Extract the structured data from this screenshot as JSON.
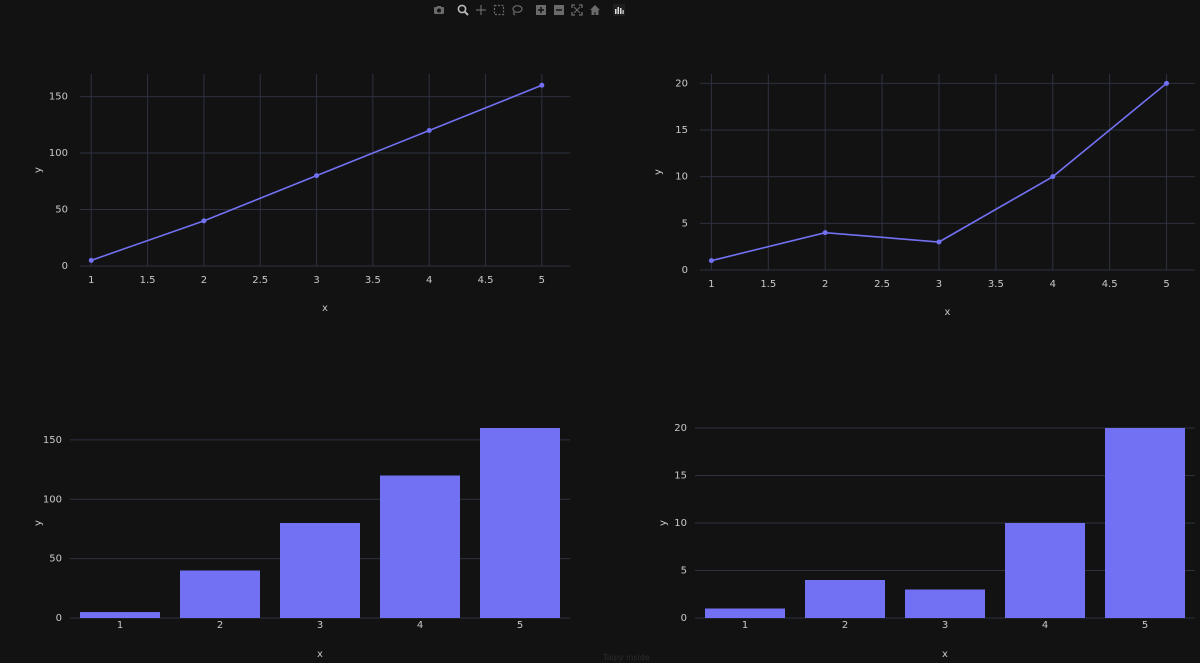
{
  "watermark": "Taipy inside",
  "modebar": {
    "icons": [
      "camera-icon",
      "zoom-icon",
      "pan-icon",
      "box-select-icon",
      "lasso-select-icon",
      "zoom-in-icon",
      "zoom-out-icon",
      "autoscale-icon",
      "reset-axes-icon",
      "plotly-logo-icon"
    ]
  },
  "colors": {
    "background": "#121212",
    "grid": "#2f3140",
    "axis_text": "#c8c8c8",
    "series": "#7371f3"
  },
  "chart_data": [
    {
      "type": "line",
      "x": [
        1,
        2,
        3,
        4,
        5
      ],
      "y": [
        5,
        40,
        80,
        120,
        160
      ],
      "xlabel": "x",
      "ylabel": "y",
      "xlim": [
        0.9,
        5.25
      ],
      "ylim": [
        0,
        170
      ],
      "xticks": [
        1,
        1.5,
        2,
        2.5,
        3,
        3.5,
        4,
        4.5,
        5
      ],
      "yticks": [
        0,
        50,
        100,
        150
      ],
      "grid": true
    },
    {
      "type": "line",
      "x": [
        1,
        2,
        3,
        4,
        5
      ],
      "y": [
        1,
        4,
        3,
        10,
        20
      ],
      "xlabel": "x",
      "ylabel": "y",
      "xlim": [
        0.9,
        5.25
      ],
      "ylim": [
        0,
        21
      ],
      "xticks": [
        1,
        1.5,
        2,
        2.5,
        3,
        3.5,
        4,
        4.5,
        5
      ],
      "yticks": [
        0,
        5,
        10,
        15,
        20
      ],
      "grid": true
    },
    {
      "type": "bar",
      "categories": [
        "1",
        "2",
        "3",
        "4",
        "5"
      ],
      "values": [
        5,
        40,
        80,
        120,
        160
      ],
      "xlabel": "x",
      "ylabel": "y",
      "ylim": [
        0,
        160
      ],
      "yticks": [
        0,
        50,
        100,
        150
      ],
      "grid": true
    },
    {
      "type": "bar",
      "categories": [
        "1",
        "2",
        "3",
        "4",
        "5"
      ],
      "values": [
        1,
        4,
        3,
        10,
        20
      ],
      "xlabel": "x",
      "ylabel": "y",
      "ylim": [
        0,
        20
      ],
      "yticks": [
        0,
        5,
        10,
        15,
        20
      ],
      "grid": true
    }
  ]
}
